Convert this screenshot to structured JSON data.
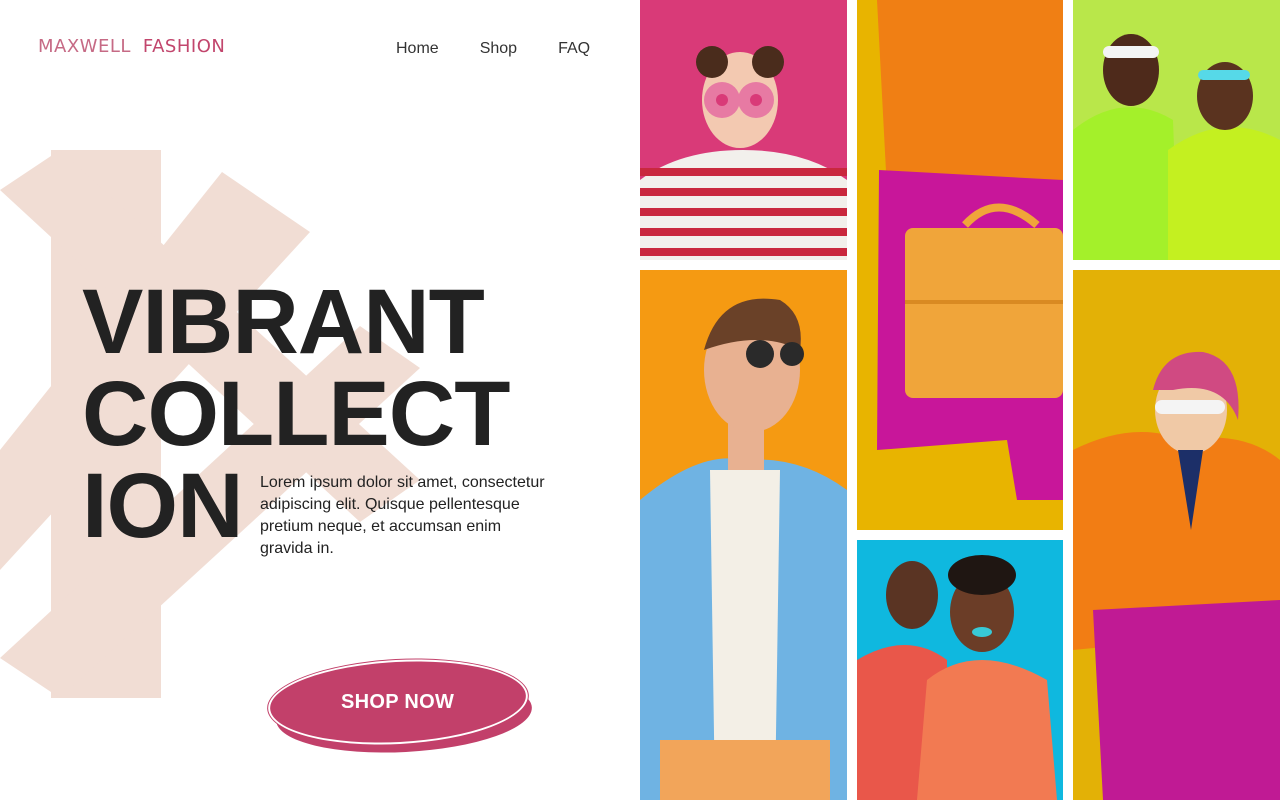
{
  "brand": {
    "word1": "MAXWELL",
    "word2": "FASHION"
  },
  "nav": {
    "items": [
      "Home",
      "Shop",
      "FAQ"
    ]
  },
  "hero": {
    "headline_lines": [
      "VIBRANT",
      "COLLECT",
      "ION"
    ],
    "description": "Lorem ipsum dolor sit amet, consectetur adipiscing elit. Quisque pellentesque pretium neque, et accumsan enim gravida in.",
    "cta_label": "SHOP NOW"
  },
  "colors": {
    "brand_pink": "#c2406a",
    "logo_pink": "#c66a85",
    "asterisk": "#f1ddd4",
    "text_dark": "#222222"
  },
  "gallery": {
    "photos": [
      {
        "name": "photo-woman-donuts",
        "background": "#d93a78"
      },
      {
        "name": "photo-man-sunglasses",
        "background": "#f59a12"
      },
      {
        "name": "photo-orange-handbag",
        "background": "#e8b400"
      },
      {
        "name": "photo-women-laughing",
        "background": "#0fb8df"
      },
      {
        "name": "photo-couple-neon",
        "background": "#b9e74a"
      },
      {
        "name": "photo-woman-scarf",
        "background": "#e3b106"
      }
    ]
  }
}
